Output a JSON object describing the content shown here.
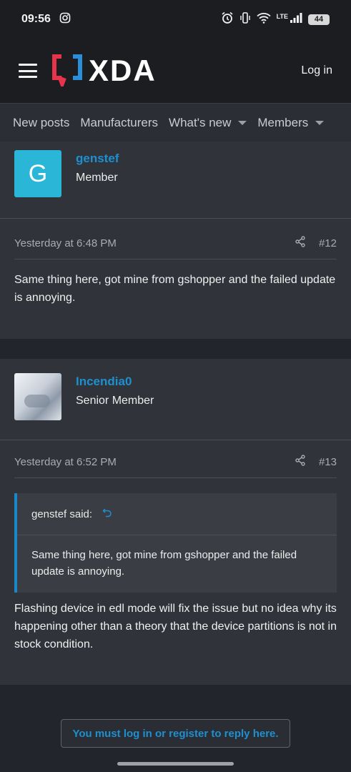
{
  "status_bar": {
    "time": "09:56",
    "network": "LTE",
    "battery": "44",
    "icons": [
      "instagram-icon",
      "alarm-icon",
      "vibrate-icon",
      "wifi-icon",
      "signal-icon",
      "battery-icon"
    ]
  },
  "header": {
    "logo_text": "XDA",
    "login_label": "Log in",
    "colors": {
      "logo_red": "#e8344a",
      "logo_blue": "#2a8fd8"
    }
  },
  "nav": {
    "items": [
      {
        "label": "New posts",
        "has_dropdown": false
      },
      {
        "label": "Manufacturers",
        "has_dropdown": false
      },
      {
        "label": "What's new",
        "has_dropdown": true
      },
      {
        "label": "Members",
        "has_dropdown": true
      }
    ]
  },
  "posts": [
    {
      "user": {
        "avatar_letter": "G",
        "name": "genstef",
        "title": "Member"
      },
      "timestamp": "Yesterday at 6:48 PM",
      "number": "#12",
      "body": "Same thing here, got mine from gshopper and the failed update is annoying."
    },
    {
      "user": {
        "avatar_letter": "",
        "name": "Incendia0",
        "title": "Senior Member"
      },
      "timestamp": "Yesterday at 6:52 PM",
      "number": "#13",
      "quote": {
        "author": "genstef said:",
        "text": "Same thing here, got mine from gshopper and the failed update is annoying."
      },
      "body": "Flashing device in edl mode will fix the issue but no idea why its happening other than a theory that the device partitions is not in stock condition."
    }
  ],
  "reply_prompt": "You must log in or register to reply here.",
  "colors": {
    "accent": "#1e8fcf",
    "background": "#22252b",
    "card": "#30333a"
  }
}
